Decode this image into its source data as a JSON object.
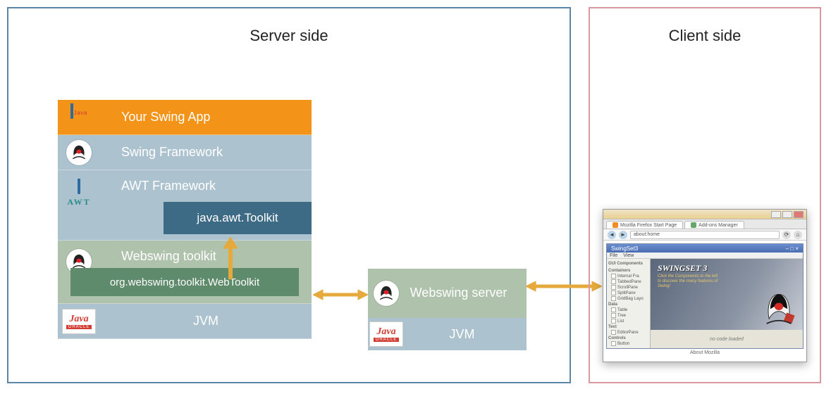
{
  "server": {
    "title": "Server side",
    "layers": {
      "app": "Your Swing App",
      "swing": "Swing Framework",
      "awt": "AWT Framework",
      "awt_toolkit": "java.awt.Toolkit",
      "webswing": "Webswing toolkit",
      "webswing_class": "org.webswing.toolkit.WebToolkit",
      "jvm": "JVM"
    },
    "server_box": {
      "name": "Webswing server",
      "jvm": "JVM"
    },
    "icons": {
      "java_text": "Java",
      "awt_text": "AWT",
      "java_oracle_java": "Java",
      "java_oracle_oracle": "ORACLE"
    }
  },
  "client": {
    "title": "Client side",
    "browser": {
      "tabs": [
        "Mozilla Firefox Start Page",
        "Add-ons Manager"
      ],
      "url": "about:home",
      "about": "About Mozilla"
    },
    "swingset": {
      "window_title": "SwingSet3",
      "menu": [
        "File",
        "View"
      ],
      "hero_title": "SWINGSET 3",
      "hero_subtitle": "Click the Components to the left to discover the many features of Swing!",
      "sidebar": {
        "header": "GUI Components",
        "cat_data": "Data",
        "items_data": [
          "Table",
          "Tree",
          "List"
        ],
        "cat_containers": "Containers",
        "items_containers": [
          "Internal Fra",
          "TabbedPane",
          "ScrollPane",
          "SplitPane",
          "GridBag Layo"
        ],
        "cat_text": "Text",
        "items_text": [
          "EditorPane"
        ],
        "cat_controls": "Controls",
        "items_controls": [
          "Button"
        ]
      },
      "loaded_text": "no code loaded"
    }
  }
}
